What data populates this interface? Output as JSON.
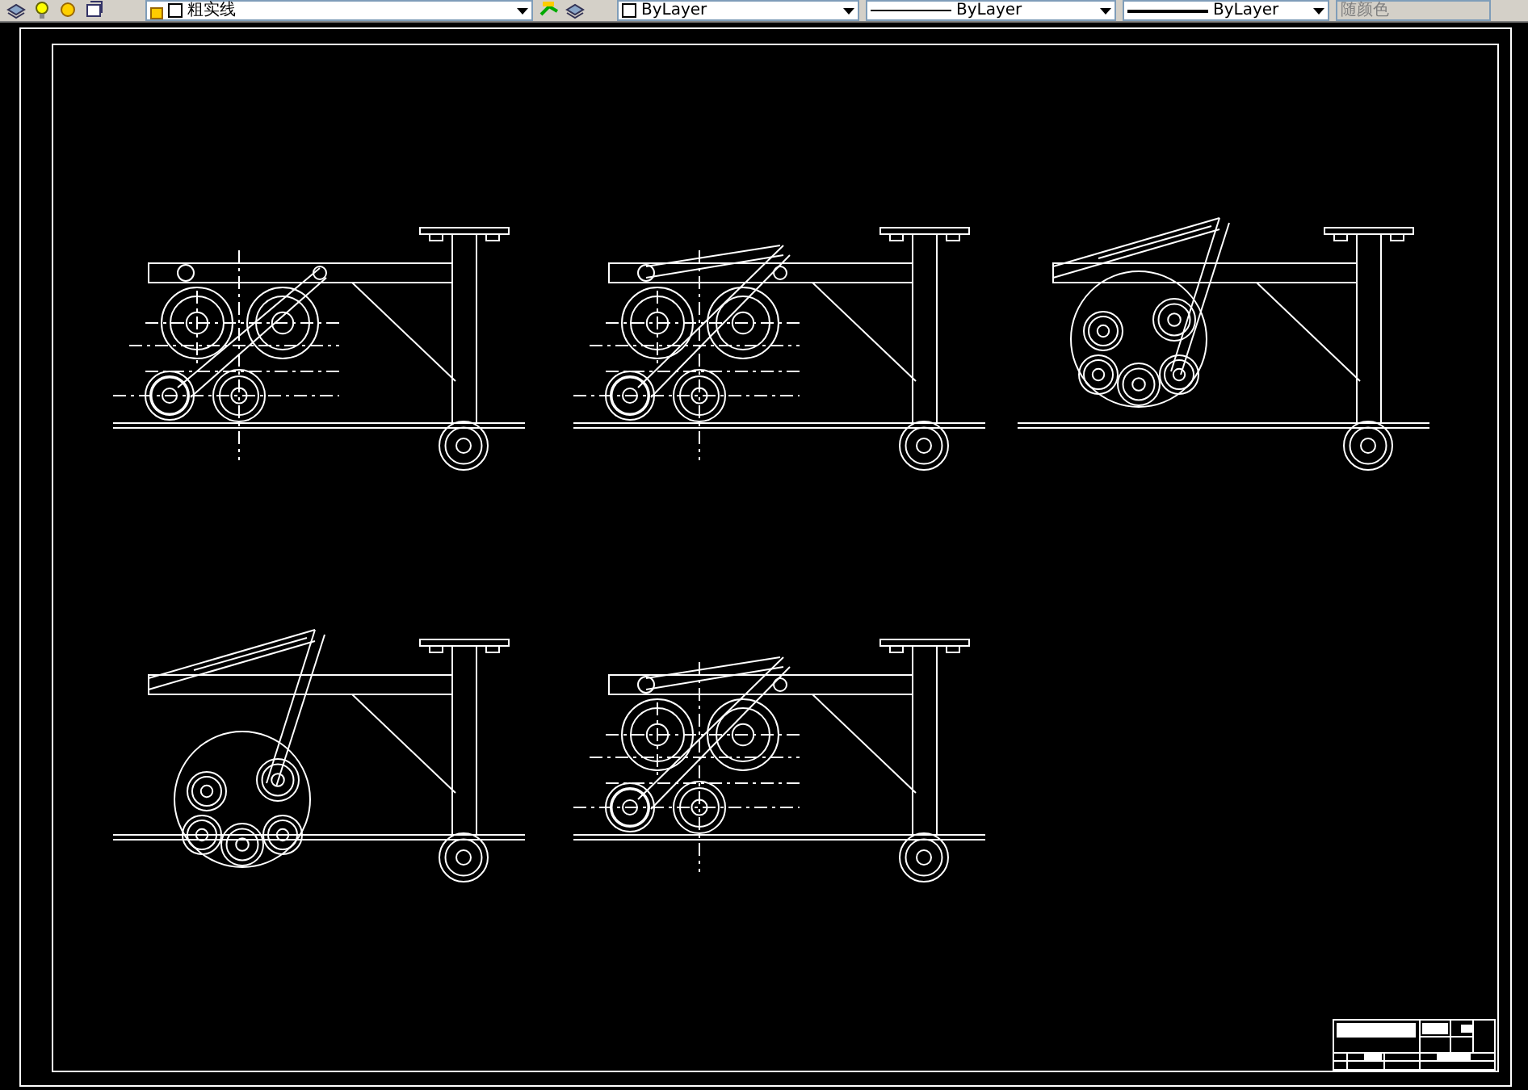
{
  "toolbar": {
    "layer": {
      "value": "粗实线"
    },
    "color": {
      "value": "ByLayer"
    },
    "linetype": {
      "value": "ByLayer"
    },
    "lineweight": {
      "value": "ByLayer"
    },
    "plot_style": {
      "value": "随颜色",
      "disabled": true
    }
  }
}
